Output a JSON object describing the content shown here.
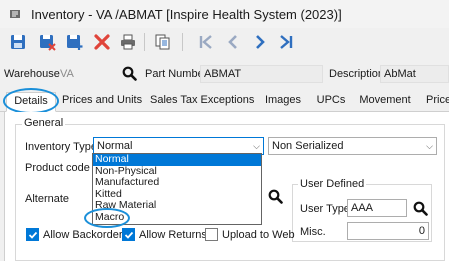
{
  "window": {
    "title": "Inventory - VA     /ABMAT [Inspire Health System (2023)]"
  },
  "toolbar": {
    "buttons": [
      "save-icon",
      "save-close-icon",
      "save-new-icon",
      "delete-icon",
      "print-icon",
      "copy-icon",
      "first-record-icon",
      "previous-record-icon",
      "next-record-icon",
      "last-record-icon"
    ]
  },
  "fields": {
    "warehouse_label": "Warehouse",
    "warehouse_value": "VA",
    "part_label": "Part Number",
    "part_value": "ABMAT",
    "description_label": "Description",
    "description_value": "AbMat"
  },
  "tabs": [
    "Details",
    "Prices and Units",
    "Sales Tax Exceptions",
    "Images",
    "UPCs",
    "Movement",
    "Price"
  ],
  "general": {
    "group_title": "General",
    "inventory_type_label": "Inventory Type",
    "inventory_type_value": "Normal",
    "serial_value": "Non Serialized",
    "product_code_label": "Product code",
    "alternate_label": "Alternate",
    "options": [
      "Normal",
      "Non-Physical",
      "Manufactured",
      "Kitted",
      "Raw Material",
      "Macro"
    ],
    "selected_option": "Normal"
  },
  "user_defined": {
    "group_title": "User Defined",
    "user_type_label": "User Type",
    "user_type_value": "AAA",
    "misc_label": "Misc.",
    "misc_value": "0"
  },
  "checkboxes": {
    "allow_backorders": {
      "label": "Allow Backorders",
      "checked": true
    },
    "allow_returns": {
      "label": "Allow Returns",
      "checked": true
    },
    "upload_to_web": {
      "label": "Upload to Web",
      "checked": false
    }
  },
  "colors": {
    "accent": "#0078d7",
    "highlight_ring": "#1a8fd9",
    "delete_red": "#e0443a",
    "nav_blue": "#2f6fbf"
  }
}
